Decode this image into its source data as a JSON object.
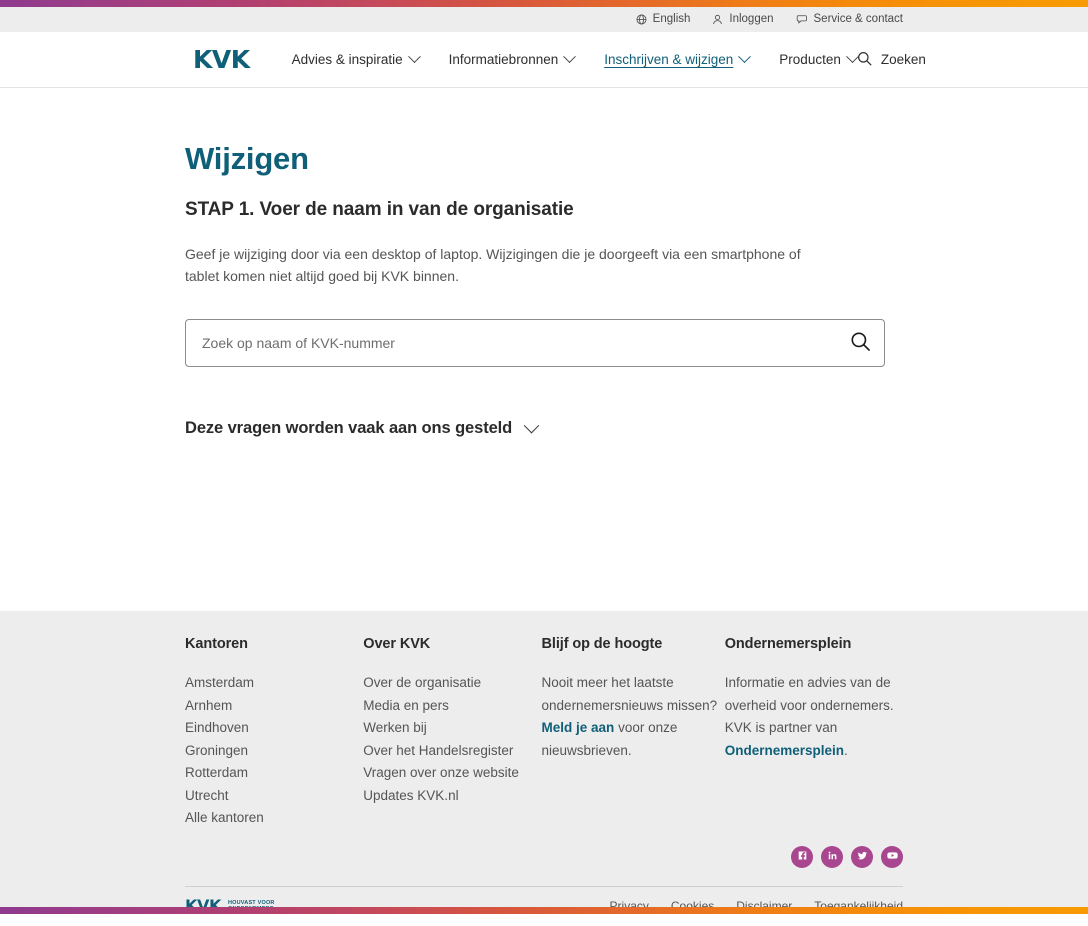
{
  "brand": {
    "logo_text": "KVK",
    "footer_logo_text": "KVK",
    "footer_tagline_line1": "HOUVAST VOOR",
    "footer_tagline_line2": "ONDERNEMERS",
    "accent_teal": "#0f5f79",
    "accent_magenta": "#a8478f",
    "gradient_start": "#8e3a8e",
    "gradient_end": "#f89b02"
  },
  "utility_bar": {
    "items": [
      {
        "label": "English",
        "icon": "globe-icon"
      },
      {
        "label": "Inloggen",
        "icon": "user-icon"
      },
      {
        "label": "Service & contact",
        "icon": "speech-bubble-icon"
      }
    ]
  },
  "nav": {
    "items": [
      {
        "label": "Advies & inspiratie",
        "has_dropdown": true,
        "active": false
      },
      {
        "label": "Informatiebronnen",
        "has_dropdown": true,
        "active": false
      },
      {
        "label": "Inschrijven & wijzigen",
        "has_dropdown": true,
        "active": true
      },
      {
        "label": "Producten",
        "has_dropdown": true,
        "active": false
      }
    ],
    "search_label": "Zoeken",
    "search_icon": "search-icon"
  },
  "main": {
    "page_title": "Wijzigen",
    "step_title": "STAP 1. Voer de naam in van de organisatie",
    "intro_text": "Geef je wijziging door via een desktop of laptop. Wijzigingen die je doorgeeft via een smartphone of tablet komen niet altijd goed bij KVK binnen.",
    "search": {
      "placeholder": "Zoek op naam of KVK-nummer",
      "value": "",
      "submit_icon": "search-icon"
    },
    "faq": {
      "label": "Deze vragen worden vaak aan ons gesteld",
      "expanded": false,
      "chevron_icon": "chevron-down-icon"
    }
  },
  "footer": {
    "columns": [
      {
        "heading": "Kantoren",
        "links": [
          "Amsterdam",
          "Arnhem",
          "Eindhoven",
          "Groningen",
          "Rotterdam",
          "Utrecht",
          "Alle kantoren"
        ]
      },
      {
        "heading": "Over KVK",
        "links": [
          "Over de organisatie",
          "Media en pers",
          "Werken bij",
          "Over het Handelsregister",
          "Vragen over onze website",
          "Updates KVK.nl"
        ]
      }
    ],
    "newsletter": {
      "heading": "Blijf op de hoogte",
      "text_before": "Nooit meer het laatste ondernemersnieuws missen? ",
      "link": "Meld je aan",
      "text_after": " voor onze nieuwsbrieven."
    },
    "ondernemersplein": {
      "heading": "Ondernemersplein",
      "text_before": "Informatie en advies van de overheid voor ondernemers. KVK is partner van ",
      "link": "Ondernemersplein",
      "text_after": "."
    },
    "social": [
      {
        "name": "facebook-icon",
        "label": "Facebook"
      },
      {
        "name": "linkedin-icon",
        "label": "LinkedIn"
      },
      {
        "name": "twitter-icon",
        "label": "Twitter"
      },
      {
        "name": "youtube-icon",
        "label": "YouTube"
      }
    ],
    "legal_links": [
      "Privacy",
      "Cookies",
      "Disclaimer",
      "Toegankelijkheid"
    ]
  }
}
